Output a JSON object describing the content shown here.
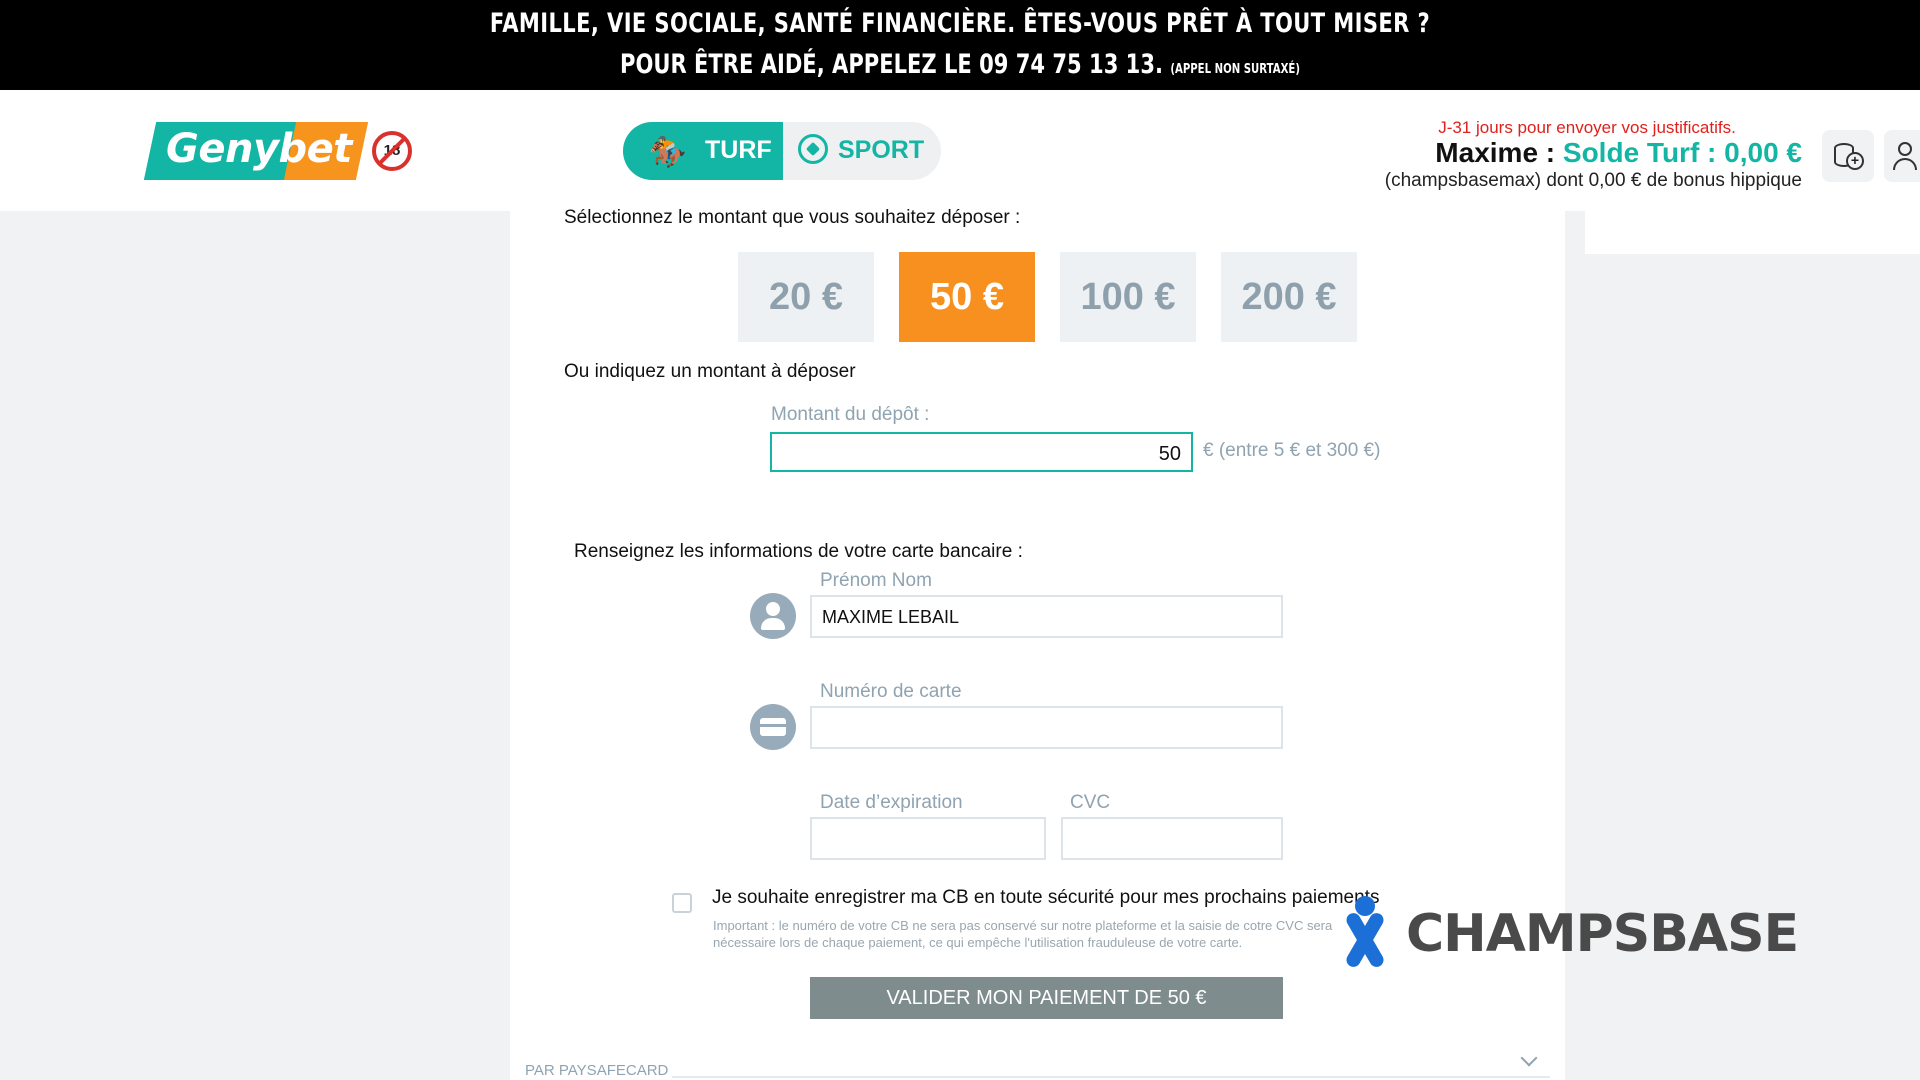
{
  "banner": {
    "line1": "FAMILLE, VIE SOCIALE, SANTÉ FINANCIÈRE. ÊTES-VOUS PRÊT À TOUT MISER ?",
    "line2": "POUR ÊTRE AIDÉ, APPELEZ LE 09 74 75 13 13.",
    "line2_small": "(APPEL NON SURTAXÉ)"
  },
  "header": {
    "logo_text": "Genybet",
    "age_badge": "18",
    "tabs": [
      {
        "label": "TURF",
        "icon": "horse-icon",
        "active": true
      },
      {
        "label": "SPORT",
        "icon": "soccer-ball-icon",
        "active": false
      }
    ],
    "user": {
      "warning": "J-31 jours pour envoyer vos justificatifs.",
      "name": "Maxime :",
      "balance": "Solde Turf : 0,00 €",
      "sub": "(champsbasemax) dont 0,00 € de bonus hippique"
    },
    "icons": [
      "deposit-icon",
      "account-icon"
    ]
  },
  "deposit": {
    "select_label": "Sélectionnez le montant que vous souhaitez déposer :",
    "amounts": [
      "20 €",
      "50 €",
      "100 €",
      "200 €"
    ],
    "selected_amount": "50 €",
    "or_label": "Ou indiquez un montant à déposer",
    "amount_field_label": "Montant du dépôt :",
    "amount_value": "50",
    "amount_hint": "€ (entre 5 € et 300 €)"
  },
  "card": {
    "section_label": "Renseignez les informations de votre carte bancaire :",
    "name_label": "Prénom Nom",
    "name_value": "MAXIME LEBAIL",
    "number_label": "Numéro de carte",
    "number_value": "",
    "expiry_label": "Date d’expiration",
    "cvc_label": "CVC",
    "save_label": "Je souhaite enregistrer ma CB en toute sécurité pour mes prochains paiements",
    "save_note": "Important : le numéro de votre CB ne sera pas conservé sur notre plateforme et la saisie de cotre CVC sera nécessaire lors de chaque paiement, ce qui empêche l'utilisation frauduleuse de votre carte.",
    "submit_label": "VALIDER MON PAIEMENT DE 50 €"
  },
  "paysafecard_label": "PAR PAYSAFECARD",
  "watermark": "CHAMPSBASE",
  "colors": {
    "brand_teal": "#13b5a4",
    "brand_orange": "#f7941d",
    "warning_red": "#e0201c"
  }
}
